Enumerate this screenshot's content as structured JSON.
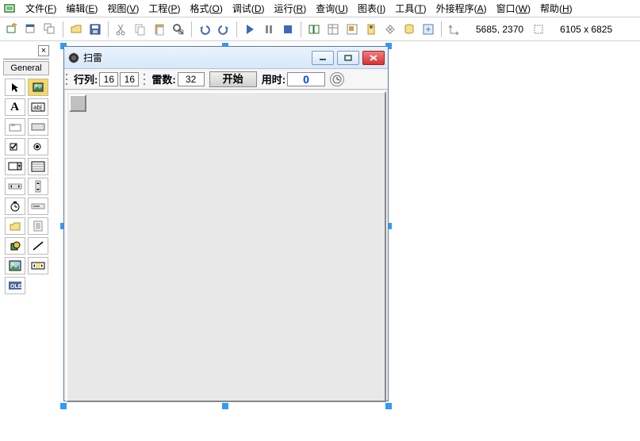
{
  "menu": {
    "items": [
      {
        "label": "文件",
        "key": "F"
      },
      {
        "label": "编辑",
        "key": "E"
      },
      {
        "label": "视图",
        "key": "V"
      },
      {
        "label": "工程",
        "key": "P"
      },
      {
        "label": "格式",
        "key": "O"
      },
      {
        "label": "调试",
        "key": "D"
      },
      {
        "label": "运行",
        "key": "R"
      },
      {
        "label": "查询",
        "key": "U"
      },
      {
        "label": "图表",
        "key": "I"
      },
      {
        "label": "工具",
        "key": "T"
      },
      {
        "label": "外接程序",
        "key": "A"
      },
      {
        "label": "窗口",
        "key": "W"
      },
      {
        "label": "帮助",
        "key": "H"
      }
    ]
  },
  "status": {
    "coords": "5685, 2370",
    "size": "6105 x 6825"
  },
  "palette": {
    "close_label": "×",
    "tab": "General"
  },
  "designer": {
    "window": {
      "title": "扫雷",
      "controls": {
        "rows_cols_label": "行列:",
        "rows": "16",
        "cols": "16",
        "mines_label": "雷数:",
        "mines": "32",
        "start_label": "开始",
        "time_label": "用时:",
        "time_value": "0"
      }
    }
  }
}
